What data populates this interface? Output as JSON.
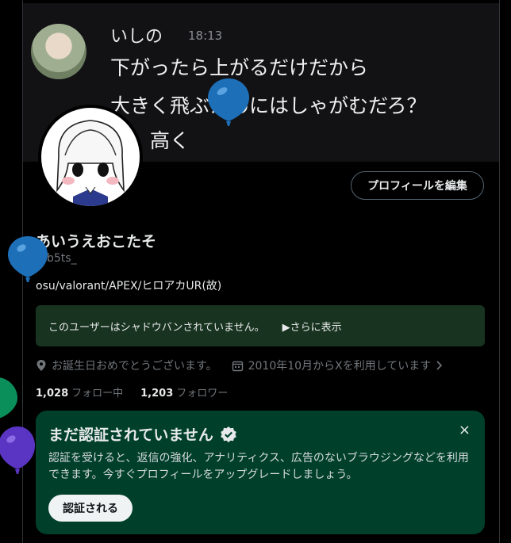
{
  "banner": {
    "name": "いしの",
    "time": "18:13",
    "line1": "下がったら上がるだけだから",
    "line2": "大きく飛ぶためにはしゃがむだろ？",
    "line3": "ぶ、高く"
  },
  "profile": {
    "edit_label": "プロフィールを編集",
    "display_name": "あいうえおこたそ",
    "handle": "@b5ts_",
    "bio": "osu/valorant/APEX/ヒロアカUR(故)"
  },
  "shadowban": {
    "text": "このユーザーはシャドウバンされていません。",
    "more": "▶さらに表示"
  },
  "meta": {
    "location": "お誕生日おめでとうございます。",
    "joined": "2010年10月からXを利用しています"
  },
  "follows": {
    "following_count": "1,028",
    "following_label": "フォロー中",
    "followers_count": "1,203",
    "followers_label": "フォロワー"
  },
  "verify": {
    "title": "まだ認証されていません",
    "close": "×",
    "description": "認証を受けると、返信の強化、アナリティクス、広告のないブラウジングなどを利用できます。今すぐプロフィールをアップグレードしましょう。",
    "button": "認証される"
  },
  "colors": {
    "background": "#000000",
    "shadow_box": "#18331f",
    "verify_card": "#00402b",
    "balloon_blue": "#1d6fb8",
    "balloon_green": "#0b8f5a",
    "balloon_purple": "#5a35c4"
  }
}
